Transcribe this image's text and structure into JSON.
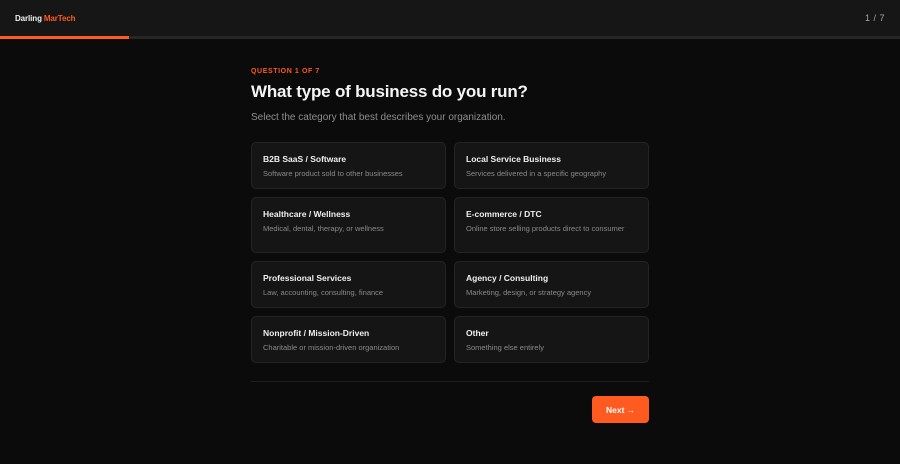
{
  "header": {
    "brand_first": "Darling",
    "brand_second": "MarTech",
    "step_counter": "1 / 7",
    "progress_fraction": 0.1429,
    "accent_color": "#ff5a1f"
  },
  "question": {
    "label": "QUESTION 1 OF 7",
    "title": "What type of business do you run?",
    "subtitle": "Select the category that best describes your organization."
  },
  "options": [
    {
      "title": "B2B SaaS / Software",
      "desc": "Software product sold to other businesses"
    },
    {
      "title": "Local Service Business",
      "desc": "Services delivered in a specific geography"
    },
    {
      "title": "Healthcare / Wellness",
      "desc": "Medical, dental, therapy, or wellness"
    },
    {
      "title": "E-commerce / DTC",
      "desc": "Online store selling products direct to consumer"
    },
    {
      "title": "Professional Services",
      "desc": "Law, accounting, consulting, finance"
    },
    {
      "title": "Agency / Consulting",
      "desc": "Marketing, design, or strategy agency"
    },
    {
      "title": "Nonprofit / Mission-Driven",
      "desc": "Charitable or mission-driven organization"
    },
    {
      "title": "Other",
      "desc": "Something else entirely"
    }
  ],
  "footer": {
    "next_label": "Next",
    "next_arrow": "→"
  }
}
